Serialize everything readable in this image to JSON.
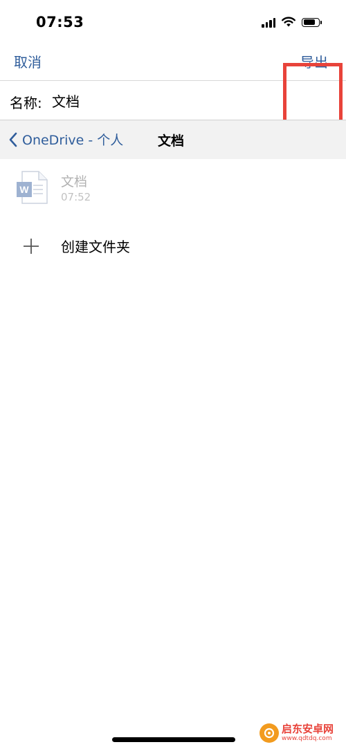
{
  "status_bar": {
    "time": "07:53"
  },
  "nav": {
    "cancel_label": "取消",
    "export_label": "导出"
  },
  "name_field": {
    "label": "名称:",
    "value": "文档"
  },
  "breadcrumb": {
    "back_label": "OneDrive - 个人",
    "current_folder": "文档"
  },
  "files": [
    {
      "name": "文档",
      "time": "07:52",
      "icon": "word-file-icon"
    }
  ],
  "create_folder": {
    "label": "创建文件夹"
  },
  "watermark": {
    "title": "启东安卓网",
    "url": "www.qdtdq.com"
  },
  "colors": {
    "accent": "#2f5d9b",
    "highlight": "#e8433a",
    "word_blue": "#2b579a"
  }
}
